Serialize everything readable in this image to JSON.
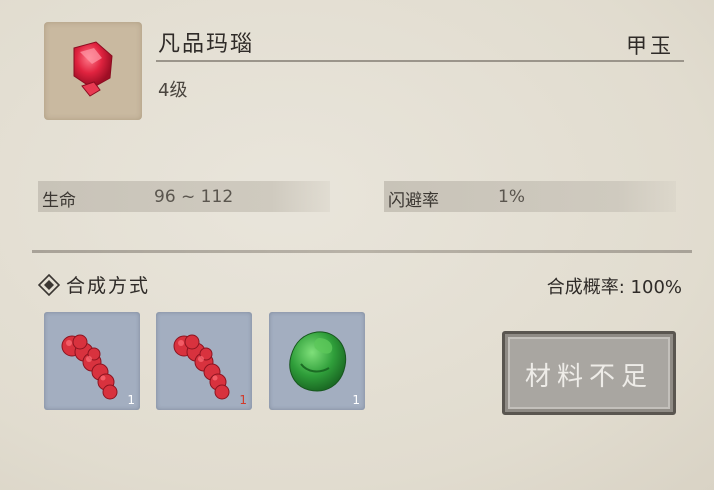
{
  "item": {
    "name": "凡品玛瑙",
    "type": "甲玉",
    "level": "4级",
    "icon": "red-agate-gem-icon"
  },
  "stats": [
    {
      "label": "生命",
      "value": "96 ~ 112"
    },
    {
      "label": "闪避率",
      "value": "1%"
    }
  ],
  "synthesis": {
    "title": "合成方式",
    "rate_label": "合成概率: 100%",
    "materials": [
      {
        "icon": "red-coral-icon",
        "count": "1",
        "enough": true
      },
      {
        "icon": "red-coral-icon",
        "count": "1",
        "enough": false
      },
      {
        "icon": "green-jade-icon",
        "count": "1",
        "enough": true
      }
    ],
    "button_label": "材料不足"
  },
  "colors": {
    "background": "#e4dfd4",
    "slot": "#a3aec0",
    "insufficient": "#d23a2a",
    "button": "#a9a6a1"
  }
}
